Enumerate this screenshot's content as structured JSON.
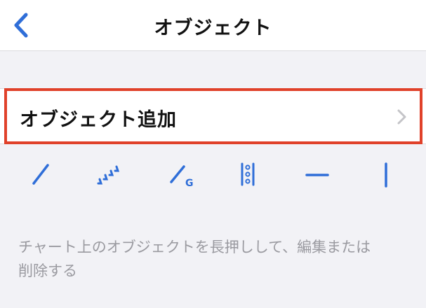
{
  "header": {
    "title": "オブジェクト",
    "back_icon": "chevron-left-icon"
  },
  "add_object": {
    "label": "オブジェクト追加",
    "chevron_icon": "chevron-right-icon"
  },
  "tools": [
    {
      "name": "trend-line-icon"
    },
    {
      "name": "parallel-channel-icon"
    },
    {
      "name": "gann-line-icon"
    },
    {
      "name": "fibonacci-icon"
    },
    {
      "name": "horizontal-line-icon"
    },
    {
      "name": "vertical-line-icon"
    }
  ],
  "hint": {
    "line1": "チャート上のオブジェクトを長押しして、編集または",
    "line2": "削除する"
  },
  "colors": {
    "accent": "#2f6ed8",
    "highlight": "#e0412a",
    "chevron": "#c4c4c8",
    "hint_text": "#9a9aa0"
  }
}
